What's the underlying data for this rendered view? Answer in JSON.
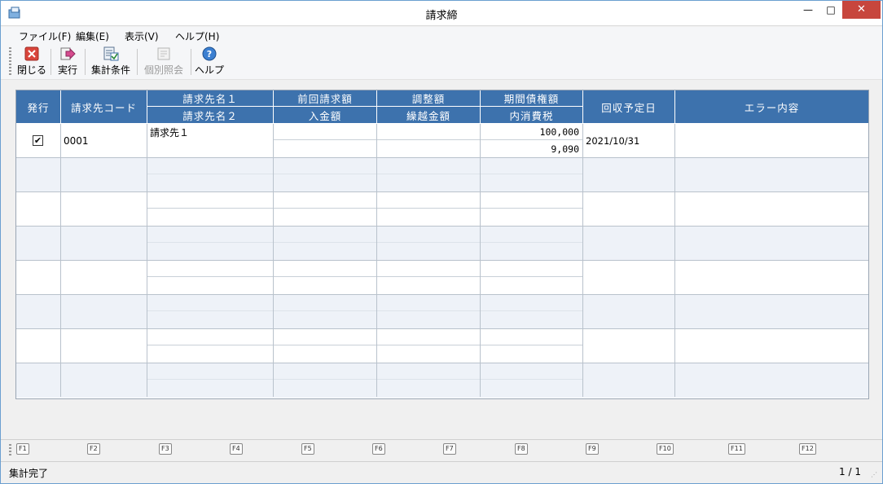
{
  "window": {
    "title": "請求締"
  },
  "menu": [
    {
      "label": "ファイル(F)"
    },
    {
      "label": "編集(E)"
    },
    {
      "label": "表示(V)"
    },
    {
      "label": "ヘルプ(H)"
    }
  ],
  "toolbar": {
    "close_label": "閉じる",
    "run_label": "実行",
    "conditions_label": "集計条件",
    "individual_label": "個別照会",
    "help_label": "ヘルプ"
  },
  "grid": {
    "headers": {
      "issue": "発行",
      "code": "請求先コード",
      "name1": "請求先名１",
      "name2": "請求先名２",
      "prev_billing": "前回請求額",
      "payment": "入金額",
      "adjustment": "調整額",
      "carryover": "繰越金額",
      "period_debt": "期間債権額",
      "tax": "内消費税",
      "collect_date": "回収予定日",
      "error": "エラー内容"
    },
    "rows": [
      {
        "issue_checked": "✔",
        "code": "0001",
        "name1": "請求先１",
        "name2": "",
        "prev_billing": "",
        "payment": "",
        "adjustment": "",
        "carryover": "",
        "period_debt": "100,000",
        "tax": "9,090",
        "collect_date": "2021/10/31",
        "error": ""
      }
    ]
  },
  "fkeys": [
    "F1",
    "F2",
    "F3",
    "F4",
    "F5",
    "F6",
    "F7",
    "F8",
    "F9",
    "F10",
    "F11",
    "F12"
  ],
  "status": {
    "message": "集計完了",
    "page": "1 / 1"
  }
}
